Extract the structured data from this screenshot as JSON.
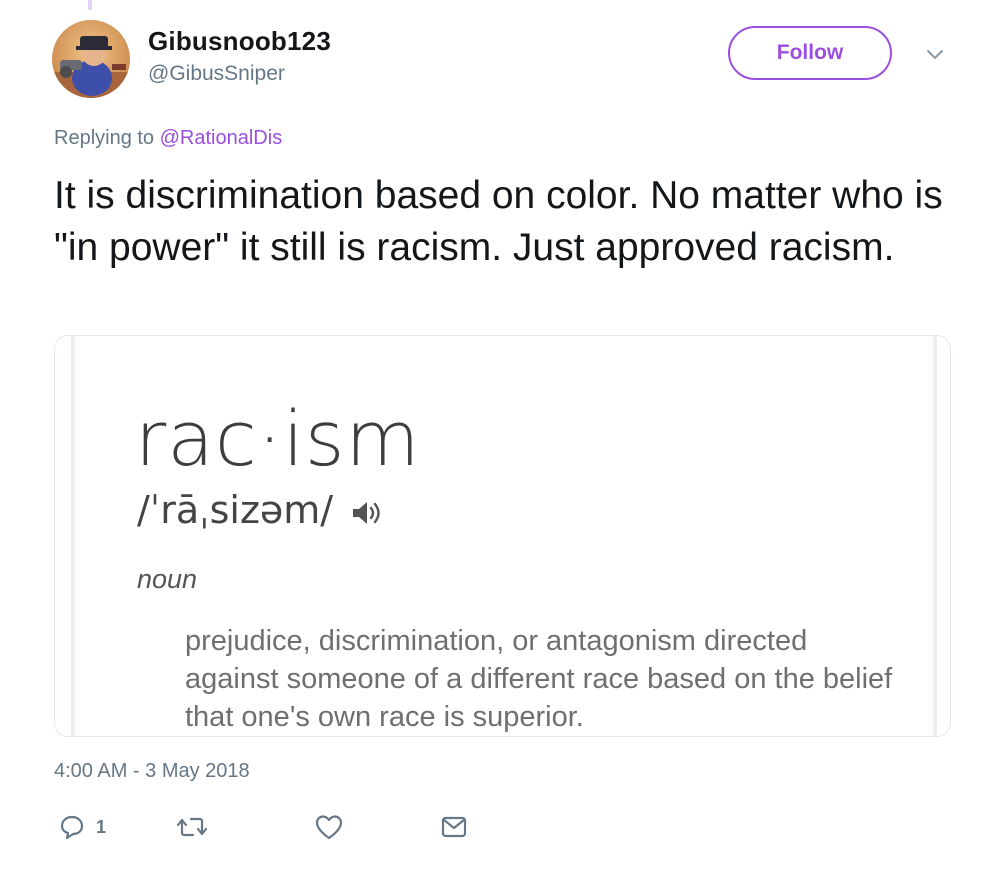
{
  "user": {
    "display_name": "Gibusnoob123",
    "handle": "@GibusSniper"
  },
  "header": {
    "follow_label": "Follow"
  },
  "reply": {
    "prefix": "Replying to ",
    "mention": "@RationalDis"
  },
  "tweet": {
    "text": "It is discrimination based on color. No matter who is \"in power\" it still is racism. Just approved racism.",
    "timestamp": "4:00 AM - 3 May 2018"
  },
  "media": {
    "word": "rac·ism",
    "pronunciation": "/ˈrāˌsizəm/",
    "part_of_speech": "noun",
    "definition": "prejudice, discrimination, or antagonism directed against someone of a different race based on the belief that one's own race is superior."
  },
  "actions": {
    "reply_count": "1"
  },
  "colors": {
    "accent": "#9a4fe0",
    "secondary_text": "#657786",
    "primary_text": "#14171a"
  }
}
